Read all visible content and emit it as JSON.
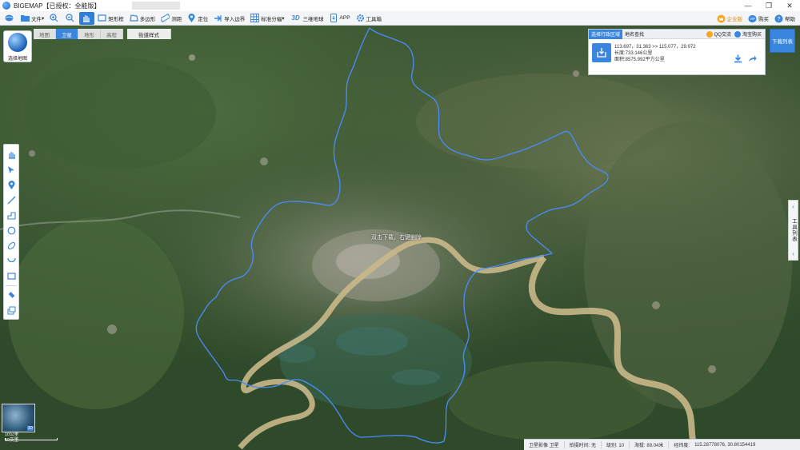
{
  "app": {
    "title": "BIGEMAP【已授权：全能版】"
  },
  "toolbar": {
    "file": "文件",
    "rect": "矩形框",
    "polygon": "多边形",
    "measure": "测距",
    "locate": "定位",
    "import": "导入边界",
    "tiling": "标准分幅",
    "three_d": "三维地球",
    "app": "APP",
    "toolbox": "工具箱",
    "enterprise": "企业版",
    "buy": "购买",
    "help": "帮助"
  },
  "maptype": {
    "select_label": "选择地图",
    "tabs": [
      "地图",
      "卫星",
      "地形",
      "高程"
    ],
    "street_style": "街道样式"
  },
  "panel": {
    "tab_admin": "选择行政区域",
    "tab_place": "地名查找",
    "qq": "QQ交流",
    "taobao": "淘宝购买",
    "coords": "113.697，31.363 >> 115.077，29.972",
    "length": "长度:733.146公里",
    "area": "面积:8575.992平方公里"
  },
  "download_list": "下载列表",
  "right_tab": "工具列表",
  "map_hint": "双击下载，右键删除",
  "scale": {
    "line1": "10公里",
    "line2": "10英里"
  },
  "minimap_badge": "3D",
  "status": {
    "source": "卫星影像 卫星",
    "capture_time": "拍摄时间: 无",
    "level": "级别: 10",
    "altitude": "海拔: 89.04米",
    "lonlat_label": "经纬度:",
    "lonlat": "115.28778076, 30.80154419"
  },
  "colors": {
    "accent": "#3a86df",
    "boundary": "#4a8cff",
    "river": "#c9b88a"
  }
}
